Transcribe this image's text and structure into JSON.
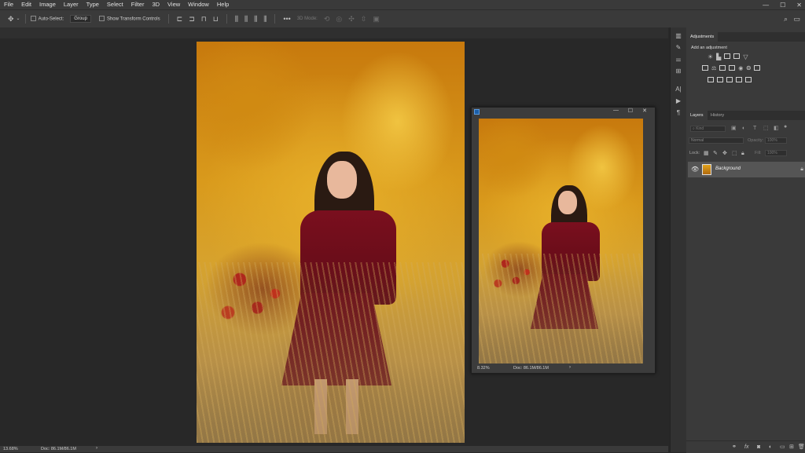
{
  "menu": [
    "File",
    "Edit",
    "Image",
    "Layer",
    "Type",
    "Select",
    "Filter",
    "3D",
    "View",
    "Window",
    "Help"
  ],
  "window_controls": {
    "minimize": "—",
    "maximize": "☐",
    "close": "✕"
  },
  "options_bar": {
    "auto_select_label": "Auto-Select:",
    "auto_select_value": "Group",
    "transform_label": "Show Transform Controls",
    "mode_3d_label": "3D Mode:"
  },
  "document": {
    "zoom": "13.68%",
    "doc_size": "Doc: 86.1M/86.1M"
  },
  "float_window": {
    "zoom": "8.32%",
    "doc_size": "Doc: 86.1M/86.1M"
  },
  "adjustments": {
    "tab": "Adjustments",
    "subtitle": "Add an adjustment"
  },
  "layers_panel": {
    "tabs": [
      "Layers",
      "History"
    ],
    "kind_placeholder": "Kind",
    "blend_mode": "Normal",
    "opacity_label": "Opacity:",
    "opacity_value": "100%",
    "lock_label": "Lock:",
    "fill_label": "Fill:",
    "fill_value": "100%",
    "layer_name": "Background"
  },
  "colors": {
    "ui_dark": "#282828",
    "ui_panel": "#3a3a3a",
    "layer_selected": "#555555"
  },
  "icons": [
    "move-tool-icon",
    "search-icon",
    "workspace-icon",
    "share-icon",
    "eye-icon",
    "lock-icon",
    "link-icon",
    "fx-icon",
    "mask-icon",
    "adjustment-layer-icon",
    "folder-icon",
    "new-layer-icon",
    "trash-icon"
  ]
}
